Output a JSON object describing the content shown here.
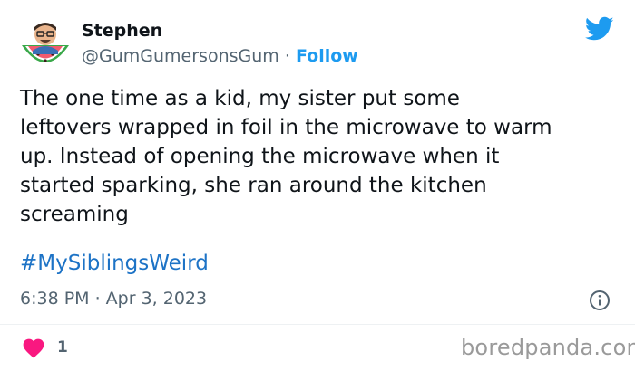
{
  "author": {
    "name": "Stephen",
    "handle": "@GumGumersonsGum",
    "separator": "·",
    "follow_label": "Follow"
  },
  "tweet": {
    "lines": [
      "The one time as a kid, my sister put some",
      "leftovers wrapped in foil in the microwave to warm",
      "up. Instead of opening the microwave when it",
      "started sparking, she ran around the kitchen",
      "screaming"
    ],
    "hashtag": "#MySiblingsWeird",
    "timestamp": "6:38 PM · Apr 3, 2023"
  },
  "engagement": {
    "like_count": "1"
  },
  "watermark": "boredpanda.com",
  "icons": {
    "brand": "twitter-bird-icon",
    "info": "info-icon",
    "like": "heart-icon",
    "avatar": "watermelon-avatar"
  },
  "colors": {
    "accent": "#1d9bf0",
    "hashtag": "#1d73c6",
    "heart": "#f91880",
    "secondary_text": "#536471",
    "primary_text": "#0f1419"
  }
}
